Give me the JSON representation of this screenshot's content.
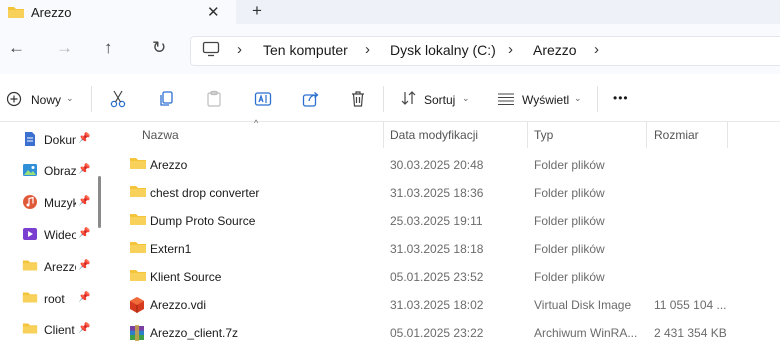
{
  "tab": {
    "title": "Arezzo",
    "close": "✕",
    "new": "+"
  },
  "nav": {
    "back": "←",
    "forward": "→",
    "up": "↑",
    "refresh": "↻",
    "crumbs": [
      "Ten komputer",
      "Dysk lokalny (C:)",
      "Arezzo"
    ],
    "separator": "›"
  },
  "toolbar": {
    "new_label": "Nowy",
    "sort_label": "Sortuj",
    "view_label": "Wyświetl",
    "more": "•••"
  },
  "sidebar": {
    "items": [
      {
        "label": "Dokumenty",
        "icon": "documents-icon",
        "color": "#3b6fd0"
      },
      {
        "label": "Obrazy",
        "icon": "pictures-icon",
        "color": "#2f8fd8"
      },
      {
        "label": "Muzyka",
        "icon": "music-icon",
        "color": "#e05a3a"
      },
      {
        "label": "Wideo",
        "icon": "videos-icon",
        "color": "#7a3fd0"
      },
      {
        "label": "Arezzo",
        "icon": "folder-icon",
        "color": "#f4c43b"
      },
      {
        "label": "root",
        "icon": "folder-icon",
        "color": "#f4c43b"
      },
      {
        "label": "Client",
        "icon": "folder-icon",
        "color": "#f4c43b"
      }
    ]
  },
  "columns": {
    "name": "Nazwa",
    "date": "Data modyfikacji",
    "type": "Typ",
    "size": "Rozmiar"
  },
  "files": [
    {
      "name": "Arezzo",
      "date": "30.03.2025 20:48",
      "type": "Folder plików",
      "size": "",
      "icon": "folder-icon"
    },
    {
      "name": "chest drop converter",
      "date": "31.03.2025 18:36",
      "type": "Folder plików",
      "size": "",
      "icon": "folder-icon"
    },
    {
      "name": "Dump Proto Source",
      "date": "25.03.2025 19:11",
      "type": "Folder plików",
      "size": "",
      "icon": "folder-icon"
    },
    {
      "name": "Extern1",
      "date": "31.03.2025 18:18",
      "type": "Folder plików",
      "size": "",
      "icon": "folder-icon"
    },
    {
      "name": "Klient Source",
      "date": "05.01.2025 23:52",
      "type": "Folder plików",
      "size": "",
      "icon": "folder-icon"
    },
    {
      "name": "Arezzo.vdi",
      "date": "31.03.2025 18:02",
      "type": "Virtual Disk Image",
      "size": "11 055 104 ...",
      "icon": "virtualbox-disk-icon"
    },
    {
      "name": "Arezzo_client.7z",
      "date": "05.01.2025 23:22",
      "type": "Archiwum WinRA...",
      "size": "2 431 354 KB",
      "icon": "winrar-archive-icon"
    }
  ],
  "colors": {
    "folder": "#f4c43b",
    "folder_dark": "#e0a91f",
    "accent": "#2b6fd0"
  }
}
